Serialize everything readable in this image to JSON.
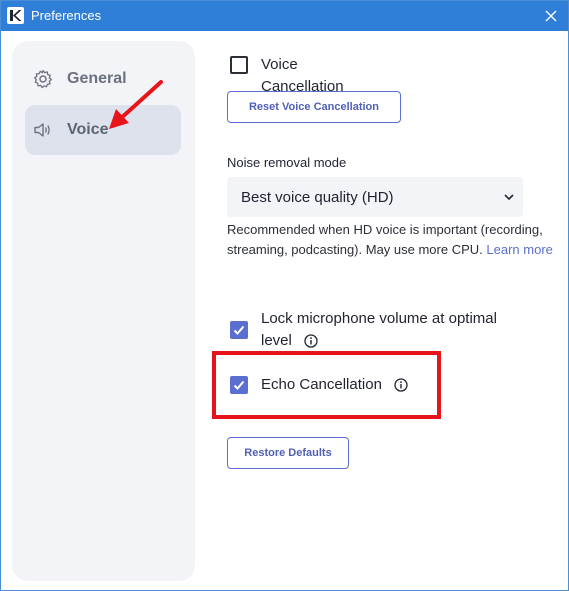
{
  "window": {
    "title": "Preferences",
    "app_icon": "k-logo-icon",
    "close_icon": "close-icon"
  },
  "sidebar": {
    "items": [
      {
        "label": "General",
        "icon": "gear-icon",
        "active": false
      },
      {
        "label": "Voice",
        "icon": "speaker-icon",
        "active": true
      }
    ]
  },
  "voice": {
    "voice_cancellation": {
      "label": "Voice Cancellation",
      "checked": false,
      "info_icon": "info-icon"
    },
    "reset_button_label": "Reset Voice Cancellation",
    "noise_removal": {
      "label": "Noise removal mode",
      "selected": "Best voice quality (HD)",
      "help_text": "Recommended when HD voice is important (recording, streaming, podcasting). May use more CPU.",
      "help_link": "Learn more"
    },
    "lock_mic": {
      "label": "Lock microphone volume at optimal level",
      "checked": true,
      "info_icon": "info-icon"
    },
    "echo_cancellation": {
      "label": "Echo Cancellation",
      "checked": true,
      "info_icon": "info-icon"
    },
    "restore_button_label": "Restore Defaults"
  },
  "colors": {
    "titlebar": "#2f7fd8",
    "accent": "#5b6fd0",
    "annotation": "#e8141c",
    "sidebar_bg": "#f3f4f7"
  }
}
